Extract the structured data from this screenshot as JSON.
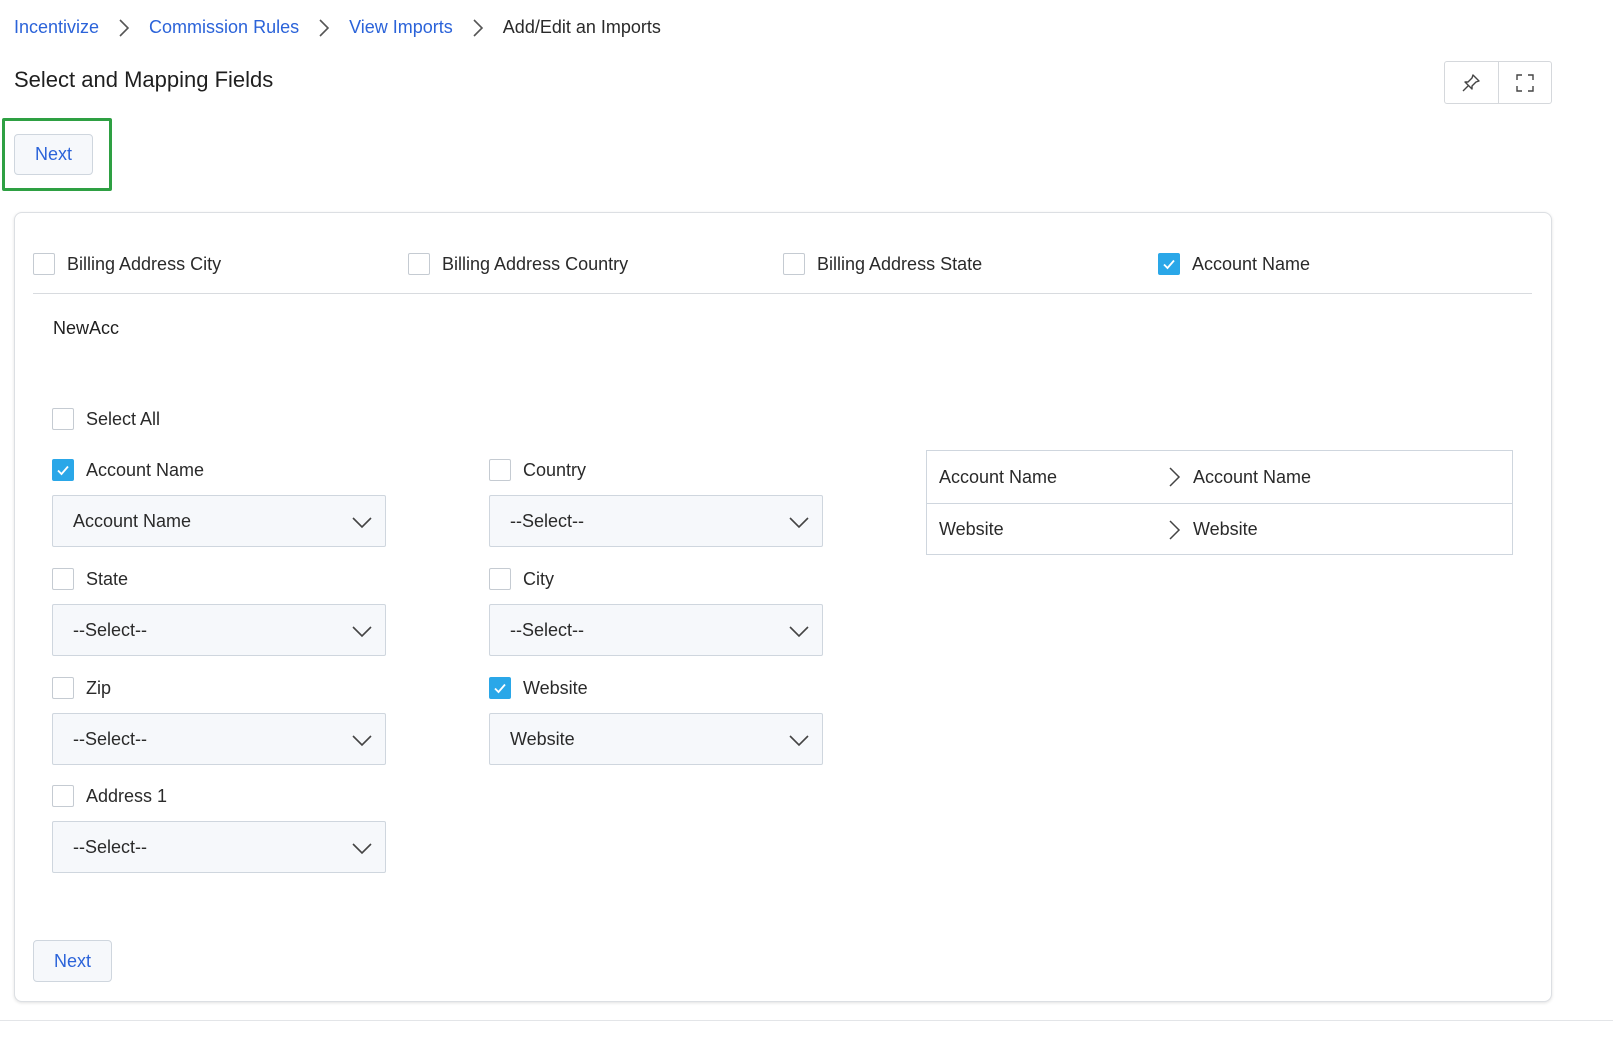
{
  "breadcrumb": {
    "items": [
      "Incentivize",
      "Commission Rules",
      "View Imports"
    ],
    "current": "Add/Edit an Imports"
  },
  "page": {
    "title": "Select and Mapping Fields"
  },
  "toolbar": {
    "pin_icon": "pin-icon",
    "fullscreen_icon": "fullscreen-icon"
  },
  "buttons": {
    "next_top": "Next",
    "next_bottom": "Next"
  },
  "top_fields": [
    {
      "label": "Billing Address City",
      "checked": false
    },
    {
      "label": "Billing Address Country",
      "checked": false
    },
    {
      "label": "Billing Address State",
      "checked": false
    },
    {
      "label": "Account Name",
      "checked": true
    }
  ],
  "section": {
    "title": "NewAcc",
    "select_all": {
      "label": "Select All",
      "checked": false
    },
    "fields": [
      {
        "label": "Account Name",
        "checked": true,
        "value": "Account Name"
      },
      {
        "label": "Country",
        "checked": false,
        "value": "--Select--"
      },
      {
        "label": "State",
        "checked": false,
        "value": "--Select--"
      },
      {
        "label": "City",
        "checked": false,
        "value": "--Select--"
      },
      {
        "label": "Zip",
        "checked": false,
        "value": "--Select--"
      },
      {
        "label": "Website",
        "checked": true,
        "value": "Website"
      },
      {
        "label": "Address 1",
        "checked": false,
        "value": "--Select--"
      }
    ]
  },
  "mapping": [
    {
      "source": "Account Name",
      "target": "Account Name"
    },
    {
      "source": "Website",
      "target": "Website"
    }
  ],
  "colors": {
    "link": "#2b63d9",
    "checkbox": "#2aa7e8",
    "highlight": "#2ea043"
  }
}
